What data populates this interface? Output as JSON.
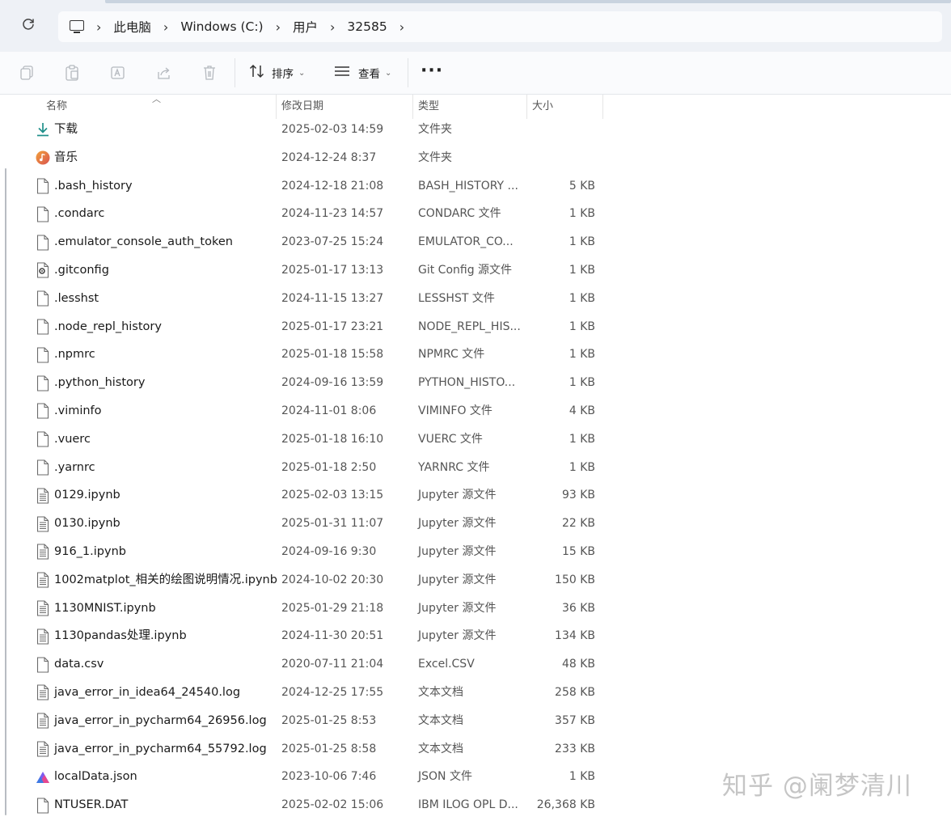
{
  "address": {
    "crumbs": [
      "此电脑",
      "Windows (C:)",
      "用户",
      "32585"
    ]
  },
  "toolbar": {
    "sort_label": "排序",
    "view_label": "查看",
    "more_label": "···"
  },
  "columns": {
    "name": "名称",
    "date": "修改日期",
    "type": "类型",
    "size": "大小"
  },
  "files": [
    {
      "name": "下载",
      "date": "2025-02-03 14:59",
      "type": "文件夹",
      "size": "",
      "icon": "download-icon"
    },
    {
      "name": "音乐",
      "date": "2024-12-24 8:37",
      "type": "文件夹",
      "size": "",
      "icon": "music-icon"
    },
    {
      "name": ".bash_history",
      "date": "2024-12-18 21:08",
      "type": "BASH_HISTORY ...",
      "size": "5 KB",
      "icon": "file-icon"
    },
    {
      "name": ".condarc",
      "date": "2024-11-23 14:57",
      "type": "CONDARC 文件",
      "size": "1 KB",
      "icon": "file-icon"
    },
    {
      "name": ".emulator_console_auth_token",
      "date": "2023-07-25 15:24",
      "type": "EMULATOR_CO...",
      "size": "1 KB",
      "icon": "file-icon"
    },
    {
      "name": ".gitconfig",
      "date": "2025-01-17 13:13",
      "type": "Git Config 源文件",
      "size": "1 KB",
      "icon": "config-file-icon"
    },
    {
      "name": ".lesshst",
      "date": "2024-11-15 13:27",
      "type": "LESSHST 文件",
      "size": "1 KB",
      "icon": "file-icon"
    },
    {
      "name": ".node_repl_history",
      "date": "2025-01-17 23:21",
      "type": "NODE_REPL_HIS...",
      "size": "1 KB",
      "icon": "file-icon"
    },
    {
      "name": ".npmrc",
      "date": "2025-01-18 15:58",
      "type": "NPMRC 文件",
      "size": "1 KB",
      "icon": "file-icon"
    },
    {
      "name": ".python_history",
      "date": "2024-09-16 13:59",
      "type": "PYTHON_HISTO...",
      "size": "1 KB",
      "icon": "file-icon"
    },
    {
      "name": ".viminfo",
      "date": "2024-11-01 8:06",
      "type": "VIMINFO 文件",
      "size": "4 KB",
      "icon": "file-icon"
    },
    {
      "name": ".vuerc",
      "date": "2025-01-18 16:10",
      "type": "VUERC 文件",
      "size": "1 KB",
      "icon": "file-icon"
    },
    {
      "name": ".yarnrc",
      "date": "2025-01-18 2:50",
      "type": "YARNRC 文件",
      "size": "1 KB",
      "icon": "file-icon"
    },
    {
      "name": "0129.ipynb",
      "date": "2025-02-03 13:15",
      "type": "Jupyter 源文件",
      "size": "93 KB",
      "icon": "text-file-icon"
    },
    {
      "name": "0130.ipynb",
      "date": "2025-01-31 11:07",
      "type": "Jupyter 源文件",
      "size": "22 KB",
      "icon": "text-file-icon"
    },
    {
      "name": "916_1.ipynb",
      "date": "2024-09-16 9:30",
      "type": "Jupyter 源文件",
      "size": "15 KB",
      "icon": "text-file-icon"
    },
    {
      "name": "1002matplot_相关的绘图说明情况.ipynb",
      "date": "2024-10-02 20:30",
      "type": "Jupyter 源文件",
      "size": "150 KB",
      "icon": "text-file-icon"
    },
    {
      "name": "1130MNIST.ipynb",
      "date": "2025-01-29 21:18",
      "type": "Jupyter 源文件",
      "size": "36 KB",
      "icon": "text-file-icon"
    },
    {
      "name": "1130pandas处理.ipynb",
      "date": "2024-11-30 20:51",
      "type": "Jupyter 源文件",
      "size": "134 KB",
      "icon": "text-file-icon"
    },
    {
      "name": "data.csv",
      "date": "2020-07-11 21:04",
      "type": "Excel.CSV",
      "size": "48 KB",
      "icon": "file-icon"
    },
    {
      "name": "java_error_in_idea64_24540.log",
      "date": "2024-12-25 17:55",
      "type": "文本文档",
      "size": "258 KB",
      "icon": "text-file-icon"
    },
    {
      "name": "java_error_in_pycharm64_26956.log",
      "date": "2025-01-25 8:53",
      "type": "文本文档",
      "size": "357 KB",
      "icon": "text-file-icon"
    },
    {
      "name": "java_error_in_pycharm64_55792.log",
      "date": "2025-01-25 8:58",
      "type": "文本文档",
      "size": "233 KB",
      "icon": "text-file-icon"
    },
    {
      "name": "localData.json",
      "date": "2023-10-06 7:46",
      "type": "JSON 文件",
      "size": "1 KB",
      "icon": "app-logo-icon"
    },
    {
      "name": "NTUSER.DAT",
      "date": "2025-02-02 15:06",
      "type": "IBM ILOG OPL D...",
      "size": "26,368 KB",
      "icon": "file-icon"
    }
  ],
  "watermark": "知乎 @阑梦清川"
}
